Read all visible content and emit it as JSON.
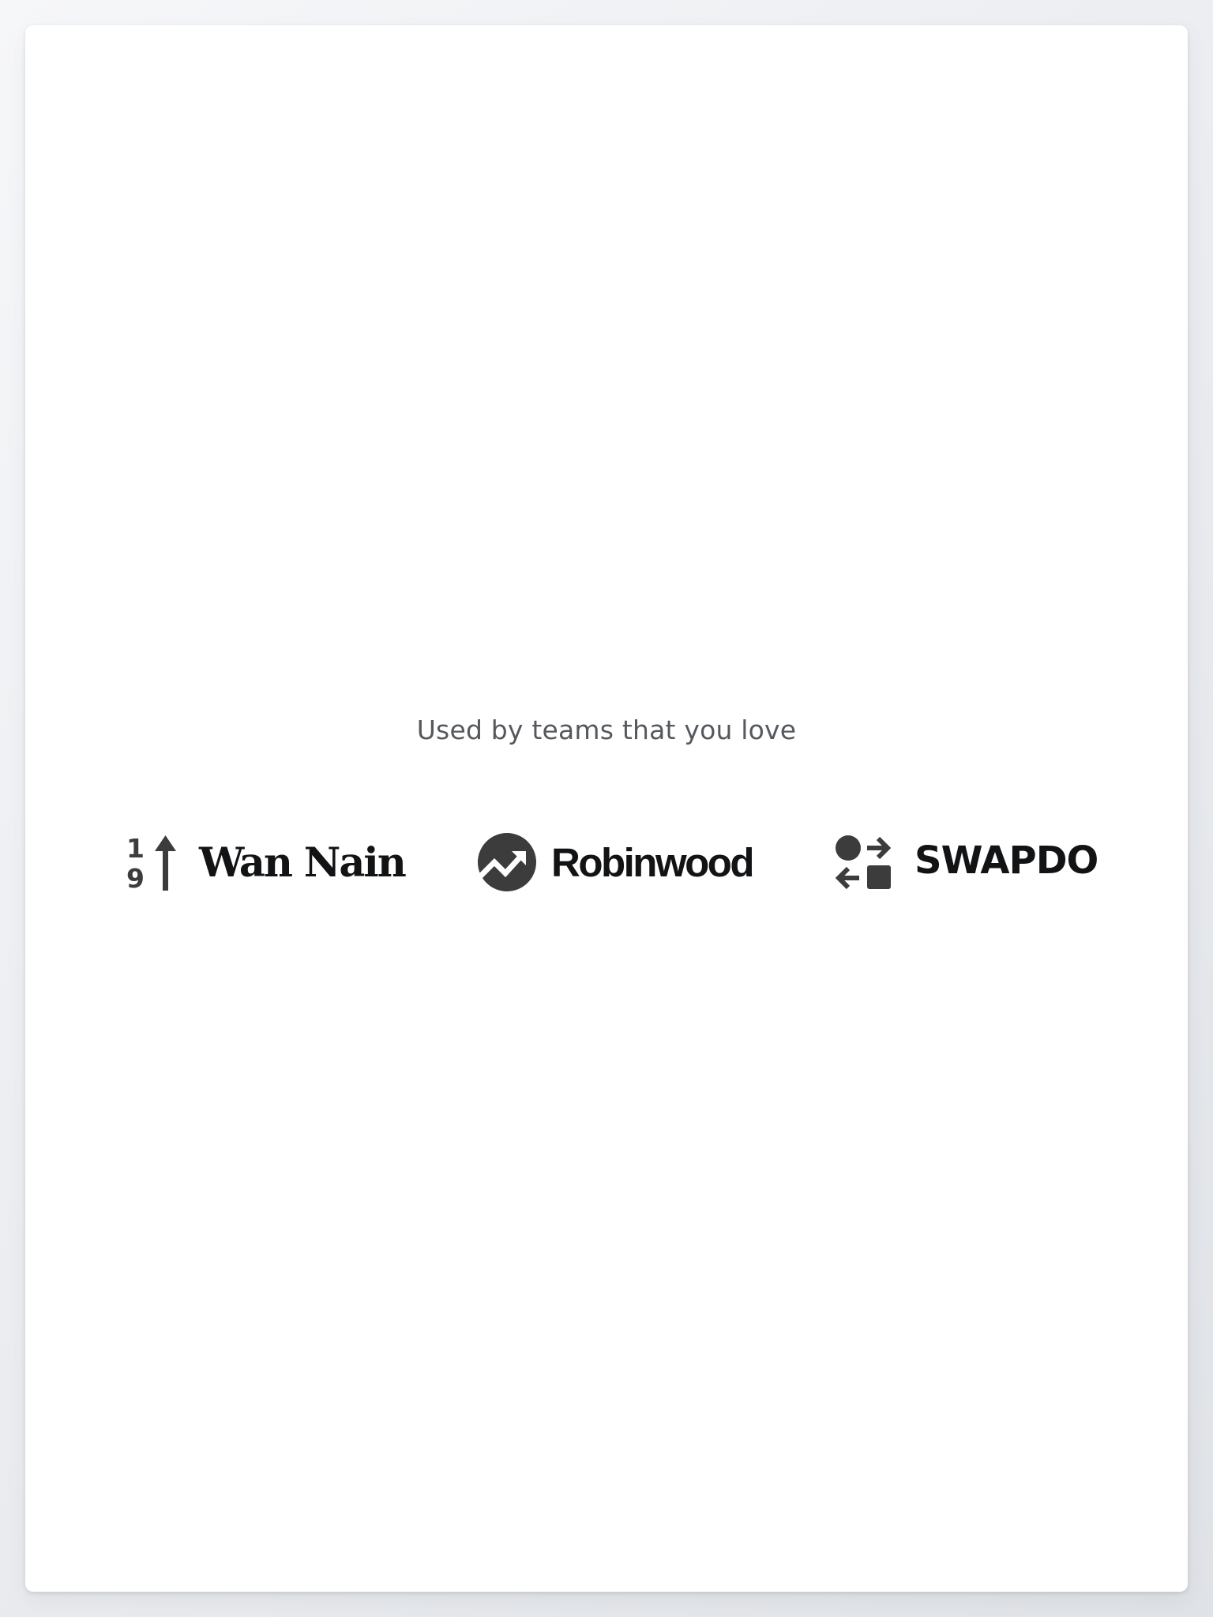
{
  "section": {
    "tagline": "Used by teams that you love"
  },
  "logos": [
    {
      "name": "Wan Nain",
      "icon": "arrow-up-19-icon"
    },
    {
      "name": "Robinwood",
      "icon": "trending-up-circle-icon"
    },
    {
      "name": "SWAPDO",
      "icon": "swap-shapes-icon"
    }
  ],
  "colors": {
    "background": "#eceef1",
    "card": "#ffffff",
    "tagline_text": "#55595e",
    "logo_mark": "#3c3c3c",
    "logo_text": "#121315"
  }
}
